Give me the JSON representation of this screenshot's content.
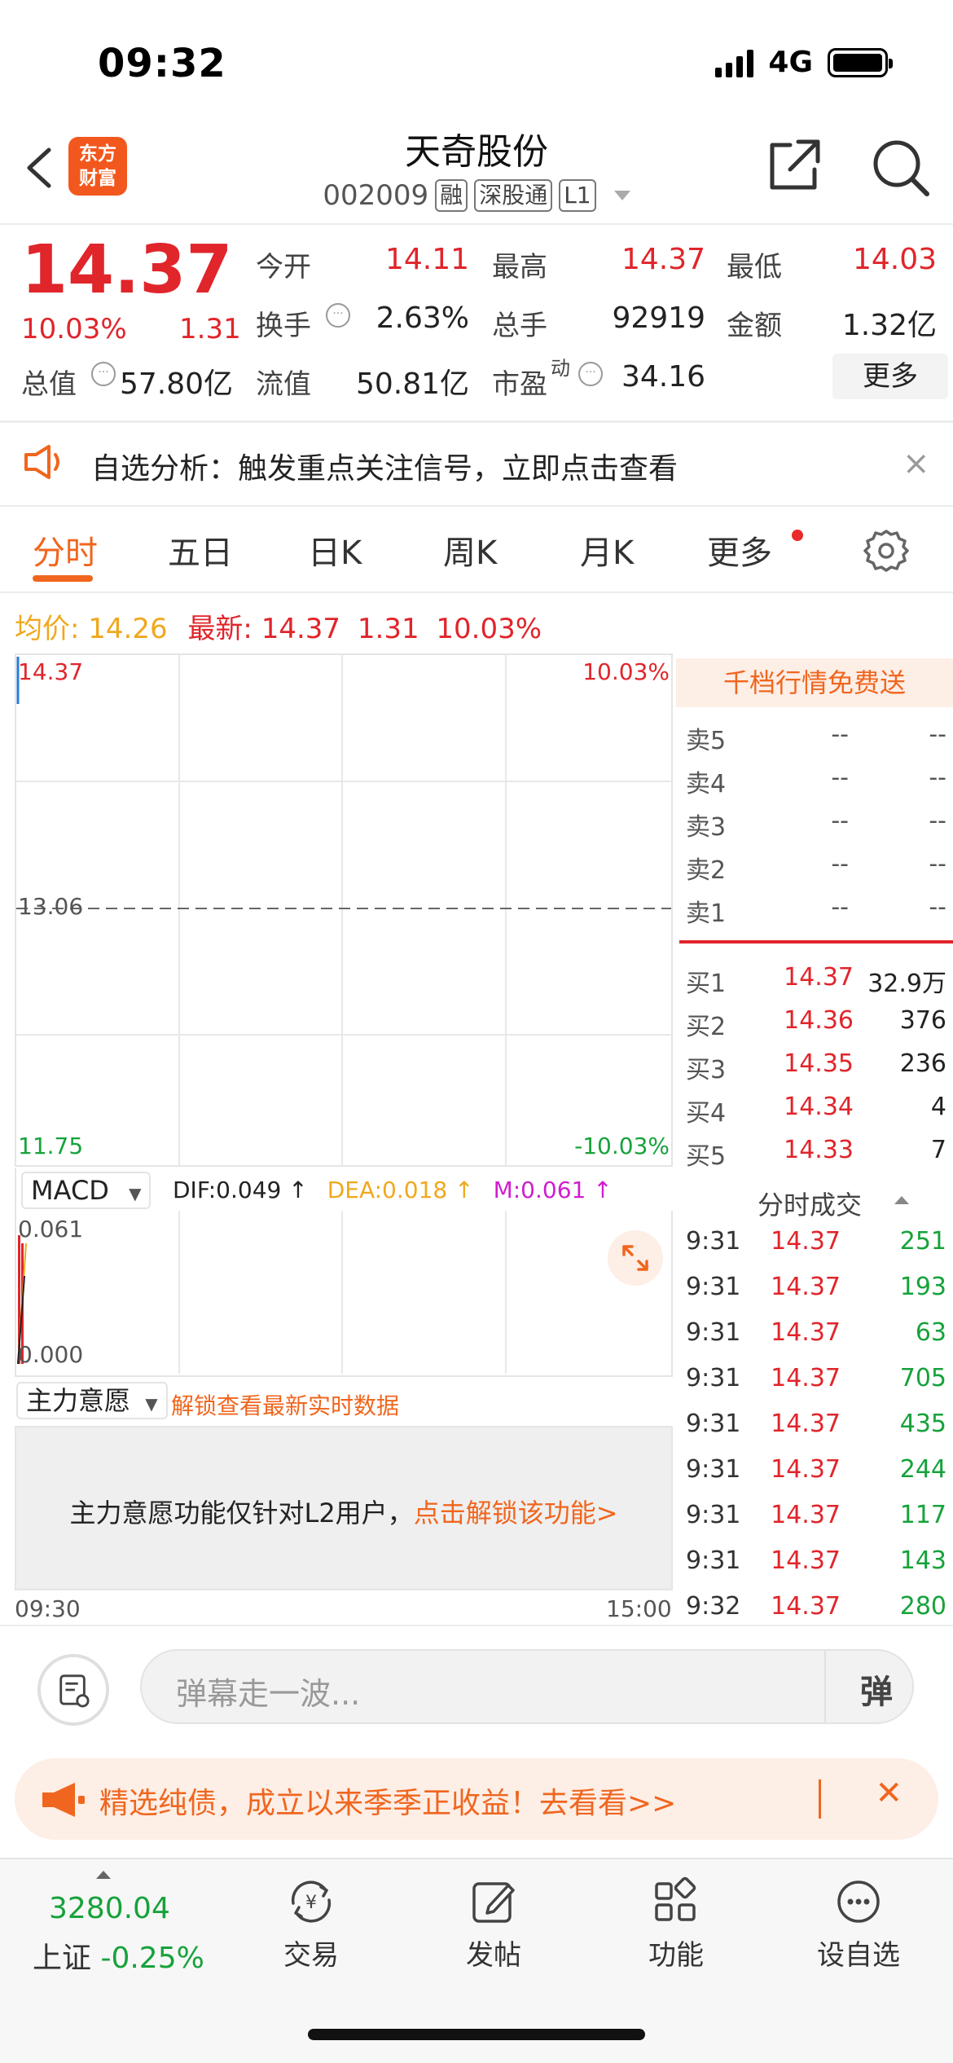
{
  "status": {
    "time": "09:32",
    "network": "4G"
  },
  "header": {
    "title": "天奇股份",
    "code": "002009",
    "tags": [
      "融",
      "深股通",
      "L1"
    ],
    "logo_text": [
      "东方",
      "财富"
    ]
  },
  "quote": {
    "price": "14.37",
    "change_pct": "10.03%",
    "change": "1.31",
    "fields": [
      {
        "label": "今开",
        "value": "14.11",
        "color": "red"
      },
      {
        "label": "最高",
        "value": "14.37",
        "color": "red"
      },
      {
        "label": "最低",
        "value": "14.03",
        "color": "red"
      },
      {
        "label": "换手",
        "value": "2.63%",
        "color": "dark"
      },
      {
        "label": "总手",
        "value": "92919",
        "color": "dark"
      },
      {
        "label": "金额",
        "value": "1.32亿",
        "color": "dark"
      },
      {
        "label": "总值",
        "value": "57.80亿",
        "color": "dark"
      },
      {
        "label": "流值",
        "value": "50.81亿",
        "color": "dark"
      },
      {
        "label": "市盈",
        "value": "34.16",
        "color": "dark"
      }
    ],
    "pe_sup": "动",
    "more_label": "更多"
  },
  "notice": {
    "text": "自选分析：触发重点关注信号，立即点击查看",
    "close": "×"
  },
  "tabs": [
    "分时",
    "五日",
    "日K",
    "周K",
    "月K",
    "更多"
  ],
  "avg_line": {
    "avg_label": "均价:",
    "avg": "14.26",
    "latest_label": "最新:",
    "latest": "14.37",
    "chg": "1.31",
    "pct": "10.03%"
  },
  "chart": {
    "y_top": "14.37",
    "y_mid": "13.06",
    "y_bottom": "11.75",
    "pct_top": "10.03%",
    "pct_bottom": "-10.03%",
    "time_start": "09:30",
    "time_end": "15:00"
  },
  "macd": {
    "selector": "MACD",
    "dif": "DIF:0.049 ↑",
    "dea": "DEA:0.018 ↑",
    "m": "M:0.061 ↑",
    "y_top": "0.061",
    "y_bottom": "0.000"
  },
  "zhuli": {
    "selector": "主力意愿",
    "link": "解锁查看最新实时数据",
    "msg": "主力意愿功能仅针对L2用户，",
    "msg_link": "点击解锁该功能>"
  },
  "orderbook": {
    "banner": "千档行情免费送",
    "asks": [
      {
        "label": "卖5",
        "price": "--",
        "vol": "--"
      },
      {
        "label": "卖4",
        "price": "--",
        "vol": "--"
      },
      {
        "label": "卖3",
        "price": "--",
        "vol": "--"
      },
      {
        "label": "卖2",
        "price": "--",
        "vol": "--"
      },
      {
        "label": "卖1",
        "price": "--",
        "vol": "--"
      }
    ],
    "bids": [
      {
        "label": "买1",
        "price": "14.37",
        "vol": "32.9万"
      },
      {
        "label": "买2",
        "price": "14.36",
        "vol": "376"
      },
      {
        "label": "买3",
        "price": "14.35",
        "vol": "236"
      },
      {
        "label": "买4",
        "price": "14.34",
        "vol": "4"
      },
      {
        "label": "买5",
        "price": "14.33",
        "vol": "7"
      }
    ],
    "trades_title": "分时成交",
    "trades": [
      {
        "t": "9:31",
        "p": "14.37",
        "v": "251"
      },
      {
        "t": "9:31",
        "p": "14.37",
        "v": "193"
      },
      {
        "t": "9:31",
        "p": "14.37",
        "v": "63"
      },
      {
        "t": "9:31",
        "p": "14.37",
        "v": "705"
      },
      {
        "t": "9:31",
        "p": "14.37",
        "v": "435"
      },
      {
        "t": "9:31",
        "p": "14.37",
        "v": "244"
      },
      {
        "t": "9:31",
        "p": "14.37",
        "v": "117"
      },
      {
        "t": "9:31",
        "p": "14.37",
        "v": "143"
      },
      {
        "t": "9:32",
        "p": "14.37",
        "v": "280"
      }
    ]
  },
  "comment": {
    "placeholder": "弹幕走一波...",
    "danmu": "弹"
  },
  "ad": {
    "text": "精选纯债，成立以来季季正收益！去看看>>",
    "close": "✕"
  },
  "nav": {
    "index_value": "3280.04",
    "index_name": "上证",
    "index_pct": "-0.25%",
    "items": [
      "交易",
      "发帖",
      "功能",
      "设自选"
    ]
  },
  "colors": {
    "red": "#e0252b",
    "green": "#17a23b",
    "orange": "#f0661e",
    "avg_yellow": "#f0a81e"
  }
}
